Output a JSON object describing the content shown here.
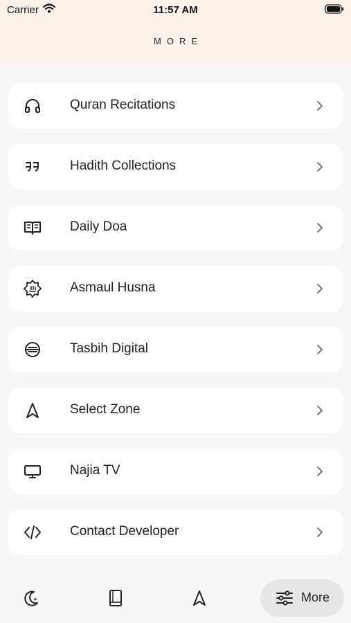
{
  "status_bar": {
    "carrier": "Carrier",
    "time": "11:57 AM"
  },
  "header": {
    "title": "MORE"
  },
  "menu": {
    "items": [
      {
        "label": "Quran Recitations",
        "icon": "headphones-icon"
      },
      {
        "label": "Hadith Collections",
        "icon": "quote-icon"
      },
      {
        "label": "Daily Doa",
        "icon": "book-open-icon"
      },
      {
        "label": "Asmaul Husna",
        "icon": "allah-badge-icon"
      },
      {
        "label": "Tasbih Digital",
        "icon": "tasbih-icon"
      },
      {
        "label": "Select Zone",
        "icon": "navigation-arrow-icon"
      },
      {
        "label": "Najia TV",
        "icon": "monitor-icon"
      },
      {
        "label": "Contact Developer",
        "icon": "code-icon"
      }
    ]
  },
  "tab_bar": {
    "tabs": [
      {
        "icon": "moon-star-icon"
      },
      {
        "icon": "book-icon"
      },
      {
        "icon": "navigation-arrow-icon"
      },
      {
        "icon": "sliders-icon",
        "label": "More",
        "active": true
      }
    ]
  },
  "colors": {
    "header_bg": "#fdf3ea",
    "page_bg": "#f7f7f7",
    "card_bg": "#ffffff",
    "active_tab_bg": "#e6e6e6"
  }
}
